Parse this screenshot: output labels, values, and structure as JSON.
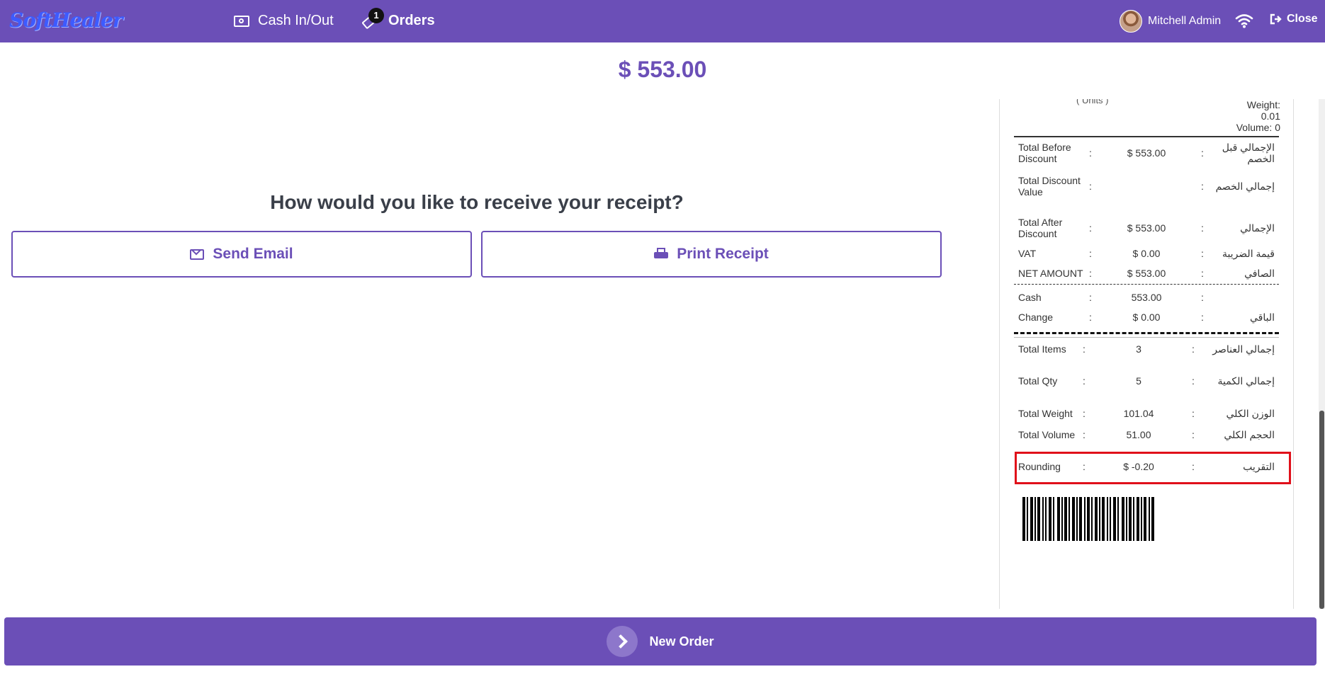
{
  "header": {
    "logo": "SoftHealer",
    "cash_label": "Cash In/Out",
    "orders_label": "Orders",
    "orders_badge": "1",
    "user_name": "Mitchell Admin",
    "close_label": "Close"
  },
  "total_amount": "$ 553.00",
  "receipt_prompt": {
    "question": "How would you like to receive your receipt?",
    "send_email": "Send Email",
    "print_receipt": "Print Receipt"
  },
  "receipt": {
    "units_text": "( Units )",
    "weight_lines": [
      "Weight:",
      "0.01",
      "Volume: 0"
    ],
    "totals": [
      {
        "label": "Total Before Discount",
        "sep": ":",
        "value": "$ 553.00",
        "sep2": ":",
        "arabic": "الإجمالي قبل الخصم"
      },
      {
        "label": "Total Discount Value",
        "sep": ":",
        "value": "",
        "sep2": ":",
        "arabic": "إجمالي الخصم"
      },
      {
        "label": "Total After Discount",
        "sep": ":",
        "value": "$ 553.00",
        "sep2": ":",
        "arabic": "الإجمالي"
      },
      {
        "label": "VAT",
        "sep": ":",
        "value": "$ 0.00",
        "sep2": ":",
        "arabic": "قيمة الضريبة"
      },
      {
        "label": "NET AMOUNT",
        "sep": ":",
        "value": "$ 553.00",
        "sep2": ":",
        "arabic": "الصافي"
      }
    ],
    "payments": [
      {
        "label": "Cash",
        "sep": ":",
        "value": "553.00",
        "sep2": ":",
        "arabic": ""
      },
      {
        "label": "Change",
        "sep": ":",
        "value": "$ 0.00",
        "sep2": ":",
        "arabic": "الباقي"
      }
    ],
    "summary": [
      {
        "label": "Total Items",
        "sep": ":",
        "value": "3",
        "sep2": ":",
        "arabic": "إجمالي العناصر"
      },
      {
        "label": "Total Qty",
        "sep": ":",
        "value": "5",
        "sep2": ":",
        "arabic": "إجمالي الكمية"
      },
      {
        "label": "Total Weight",
        "sep": ":",
        "value": "101.04",
        "sep2": ":",
        "arabic": "الوزن الكلي"
      },
      {
        "label": "Total Volume",
        "sep": ":",
        "value": "51.00",
        "sep2": ":",
        "arabic": "الحجم الكلي"
      },
      {
        "label": "Rounding",
        "sep": ":",
        "value": "$ -0.20",
        "sep2": ":",
        "arabic": "التقريب"
      }
    ]
  },
  "new_order_label": "New Order",
  "colors": {
    "brand": "#6b4fb7",
    "highlight_box": "#e0101a",
    "logo": "#3d5bff"
  }
}
